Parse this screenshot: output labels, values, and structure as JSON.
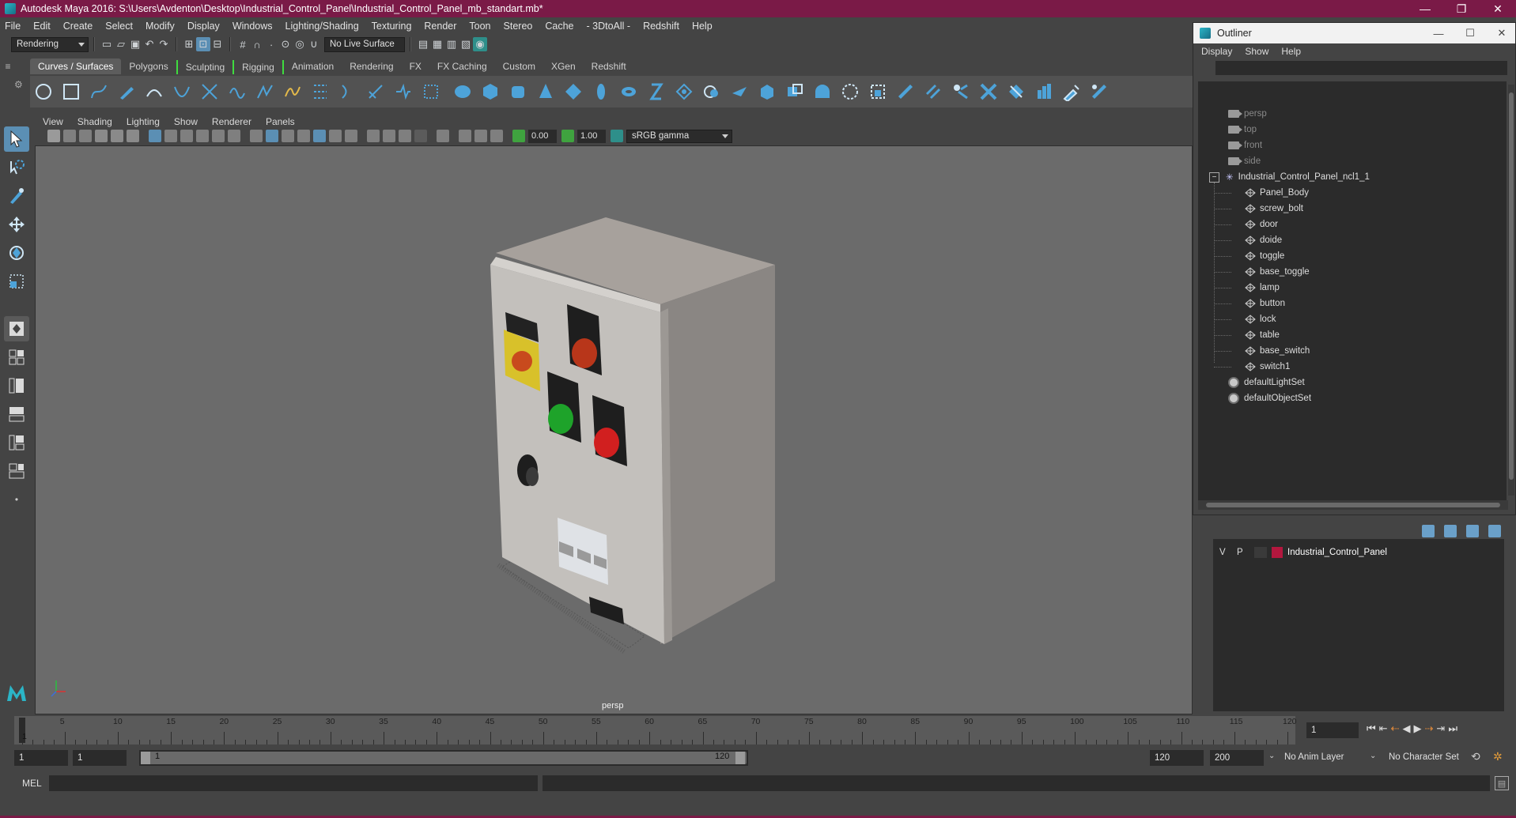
{
  "title": "Autodesk Maya 2016: S:\\Users\\Avdenton\\Desktop\\Industrial_Control_Panel\\Industrial_Control_Panel_mb_standart.mb*",
  "window_controls": [
    "—",
    "❐",
    "✕"
  ],
  "menu": [
    "File",
    "Edit",
    "Create",
    "Select",
    "Modify",
    "Display",
    "Windows",
    "Lighting/Shading",
    "Texturing",
    "Render",
    "Toon",
    "Stereo",
    "Cache",
    "- 3DtoAll -",
    "Redshift",
    "Help"
  ],
  "status": {
    "menuset": "Rendering",
    "live_surface": "No Live Surface"
  },
  "shelf_tabs": [
    "Curves / Surfaces",
    "Polygons",
    "Sculpting",
    "Rigging",
    "Animation",
    "Rendering",
    "FX",
    "FX Caching",
    "Custom",
    "XGen",
    "Redshift"
  ],
  "panel_menu": [
    "View",
    "Shading",
    "Lighting",
    "Show",
    "Renderer",
    "Panels"
  ],
  "panel_toolbar": {
    "exposure": "0.00",
    "gamma": "1.00",
    "color_space": "sRGB gamma"
  },
  "viewport": {
    "camera_label": "persp"
  },
  "outliner": {
    "title": "Outliner",
    "menu": [
      "Display",
      "Show",
      "Help"
    ],
    "cameras": [
      "persp",
      "top",
      "front",
      "side"
    ],
    "group": "Industrial_Control_Panel_ncl1_1",
    "children": [
      "Panel_Body",
      "screw_bolt",
      "door",
      "doide",
      "toggle",
      "base_toggle",
      "lamp",
      "button",
      "lock",
      "table",
      "base_switch",
      "switch1"
    ],
    "sets": [
      "defaultLightSet",
      "defaultObjectSet"
    ]
  },
  "layer_editor": {
    "layer": {
      "v": "V",
      "p": "P",
      "name": "Industrial_Control_Panel",
      "color": "#b3173e"
    }
  },
  "timeline": {
    "ticks": [
      5,
      10,
      15,
      20,
      25,
      30,
      35,
      40,
      45,
      50,
      55,
      60,
      65,
      70,
      75,
      80,
      85,
      90,
      95,
      100,
      105,
      110,
      115,
      120
    ],
    "current_frame": "1",
    "start": 1,
    "end": 120
  },
  "range": {
    "start_frame": "1",
    "playback_start": "1",
    "range_start_label": "1",
    "range_end_label": "120",
    "playback_end": "120",
    "end_frame": "200",
    "anim_layer": "No Anim Layer",
    "character_set": "No Character Set"
  },
  "cmdline": {
    "lang": "MEL"
  },
  "colors": {
    "title_bar": "#7a1a47",
    "selection": "#5b8fb4",
    "shelf_icon": "#4da3d9"
  }
}
